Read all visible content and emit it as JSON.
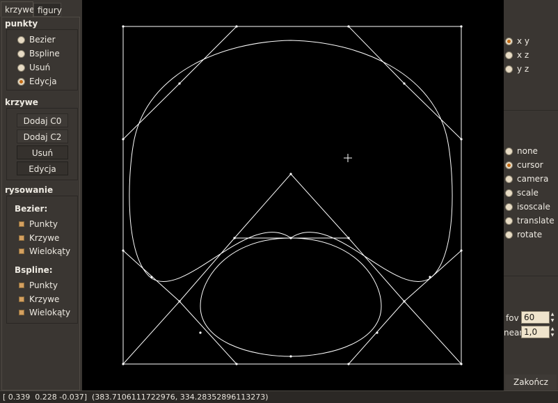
{
  "tabs": [
    "krzywe",
    "figury"
  ],
  "punkty": {
    "title": "punkty",
    "options": [
      "Bezier",
      "Bspline",
      "Usuń",
      "Edycja"
    ],
    "selected": "Edycja"
  },
  "krzywe": {
    "title": "krzywe",
    "buttons": [
      "Dodaj C0",
      "Dodaj C2",
      "Usuń",
      "Edycja"
    ]
  },
  "rysowanie": {
    "title": "rysowanie",
    "bezier_title": "Bezier:",
    "bezier_options": [
      "Punkty",
      "Krzywe",
      "Wielokąty"
    ],
    "bspline_title": "Bspline:",
    "bspline_options": [
      "Punkty",
      "Krzywe",
      "Wielokąty"
    ]
  },
  "projection": {
    "options": [
      "x y",
      "x z",
      "y z"
    ],
    "selected": "x y"
  },
  "mode": {
    "options": [
      "none",
      "cursor",
      "camera",
      "scale",
      "isoscale",
      "translate",
      "rotate"
    ],
    "selected": "cursor"
  },
  "camera": {
    "fov_label": "fov",
    "fov_value": "60",
    "near_label": "near",
    "near_value": "1,0"
  },
  "finish_button": "Zakończ",
  "status": "[ 0.339  0.228 -0.037]  (383.7106111722976, 334.28352896113273)"
}
